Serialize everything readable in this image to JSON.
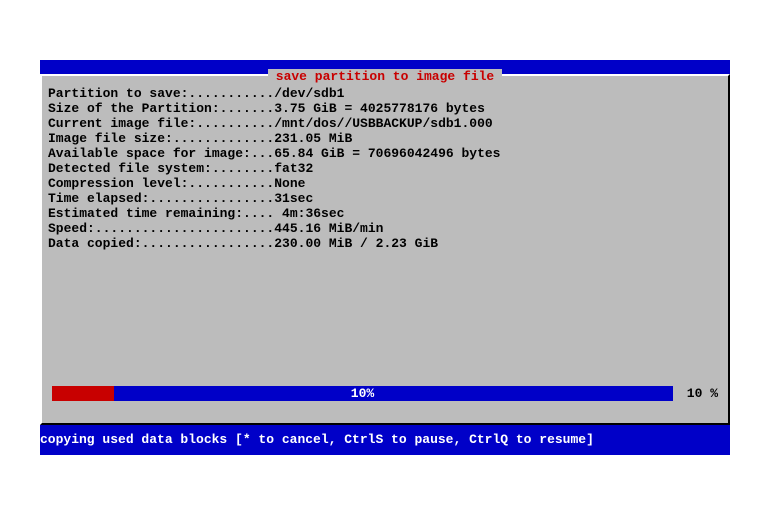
{
  "title": " save partition to image file ",
  "lines": {
    "partition_to_save": "Partition to save:.........../dev/sdb1",
    "size_of_partition": "Size of the Partition:.......3.75 GiB = 4025778176 bytes",
    "current_image_file": "Current image file:........../mnt/dos//USBBACKUP/sdb1.000",
    "image_file_size": "Image file size:.............231.05 MiB",
    "available_space": "Available space for image:...65.84 GiB = 70696042496 bytes",
    "detected_fs": "Detected file system:........fat32",
    "compression": "Compression level:...........None",
    "blank1": "",
    "blank2": "",
    "time_elapsed": "Time elapsed:................31sec",
    "eta": "Estimated time remaining:.... 4m:36sec",
    "speed": "Speed:.......................445.16 MiB/min",
    "data_copied": "Data copied:.................230.00 MiB / 2.23 GiB"
  },
  "progress": {
    "percent": 10,
    "center_label": "10%",
    "right_label": " 10 %"
  },
  "footer": "copying used data blocks [* to cancel, CtrlS to pause, CtrlQ to resume]"
}
